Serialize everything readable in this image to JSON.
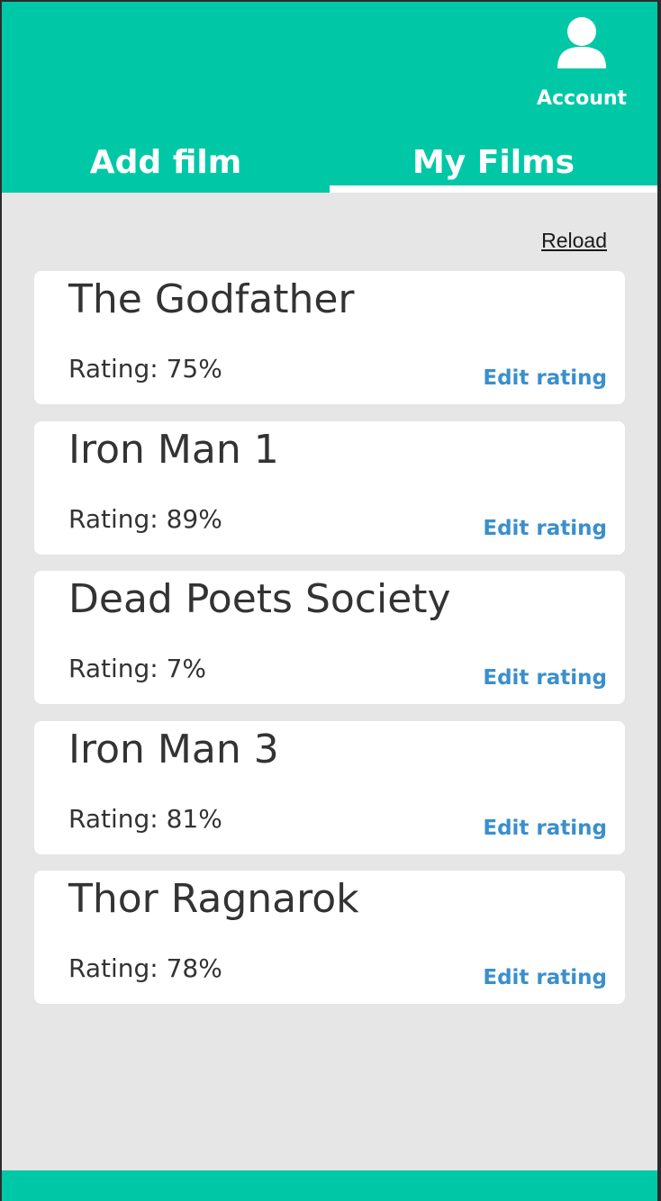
{
  "header": {
    "account_label": "Account",
    "account_icon": "user-icon",
    "accent_color": "#00c8a6"
  },
  "tabs": [
    {
      "label": "Add film",
      "active": false
    },
    {
      "label": "My Films",
      "active": true
    }
  ],
  "reload_label": "Reload",
  "films": [
    {
      "title": "The Godfather",
      "rating": "Rating: 75%",
      "edit_label": "Edit rating"
    },
    {
      "title": "Iron Man 1",
      "rating": "Rating: 89%",
      "edit_label": "Edit rating"
    },
    {
      "title": "Dead Poets Society",
      "rating": "Rating: 7%",
      "edit_label": "Edit rating"
    },
    {
      "title": "Iron Man 3",
      "rating": "Rating: 81%",
      "edit_label": "Edit rating"
    },
    {
      "title": "Thor Ragnarok",
      "rating": "Rating: 78%",
      "edit_label": "Edit rating"
    }
  ]
}
